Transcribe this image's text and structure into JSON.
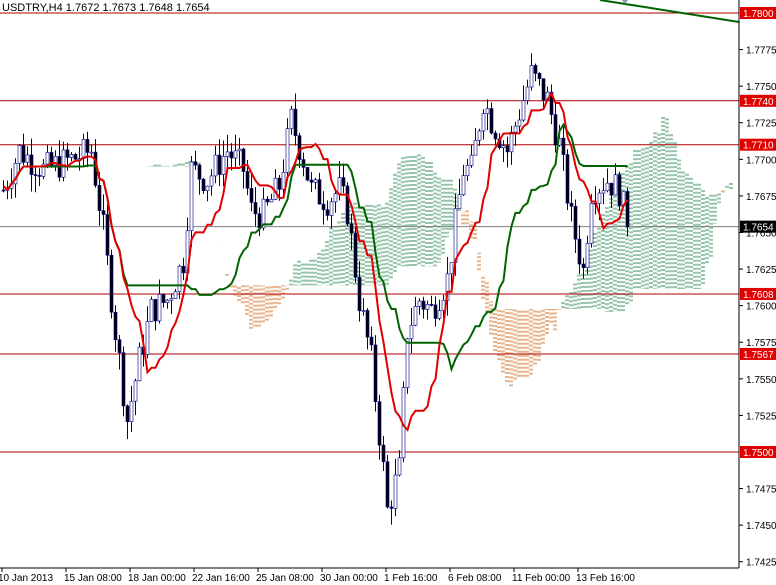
{
  "chart_data": {
    "type": "candlestick",
    "title": "USDTRY,H4",
    "ohlc_header": [
      "1.7672",
      "1.7673",
      "1.7648",
      "1.7654"
    ],
    "ylim": [
      1.7412,
      1.7809
    ],
    "y_ticks": [
      "1.7775",
      "1.7750",
      "1.7725",
      "1.7700",
      "1.7675",
      "1.7650",
      "1.7625",
      "1.7600",
      "1.7575",
      "1.7550",
      "1.7525",
      "1.7475",
      "1.7450",
      "1.7425"
    ],
    "x_labels": [
      "10 Jan 2013",
      "15 Jan 08:00",
      "18 Jan 00:00",
      "22 Jan 16:00",
      "25 Jan 08:00",
      "30 Jan 00:00",
      "1 Feb 16:00",
      "6 Feb 08:00",
      "11 Feb 00:00",
      "13 Feb 16:00"
    ],
    "bars_per_label": 16,
    "current_price": "1.7654",
    "levels": [
      "1.7800",
      "1.7740",
      "1.7710",
      "1.7608",
      "1.7567",
      "1.7500"
    ],
    "close_path_keypoints": [
      [
        0,
        1.7679
      ],
      [
        4,
        1.7706
      ],
      [
        10,
        1.7693
      ],
      [
        17,
        1.77
      ],
      [
        22,
        1.7706
      ],
      [
        25,
        1.7652
      ],
      [
        28,
        1.7583
      ],
      [
        31,
        1.7522
      ],
      [
        34,
        1.7563
      ],
      [
        37,
        1.7597
      ],
      [
        41,
        1.7604
      ],
      [
        45,
        1.7631
      ],
      [
        47,
        1.7693
      ],
      [
        51,
        1.7686
      ],
      [
        56,
        1.7706
      ],
      [
        60,
        1.7693
      ],
      [
        62,
        1.7665
      ],
      [
        65,
        1.7662
      ],
      [
        69,
        1.7682
      ],
      [
        72,
        1.7727
      ],
      [
        75,
        1.77
      ],
      [
        77,
        1.7679
      ],
      [
        81,
        1.7672
      ],
      [
        84,
        1.7679
      ],
      [
        86,
        1.7665
      ],
      [
        89,
        1.7604
      ],
      [
        92,
        1.7563
      ],
      [
        95,
        1.7488
      ],
      [
        96,
        1.746
      ],
      [
        99,
        1.7488
      ],
      [
        101,
        1.7583
      ],
      [
        104,
        1.7604
      ],
      [
        107,
        1.7597
      ],
      [
        111,
        1.7618
      ],
      [
        115,
        1.7693
      ],
      [
        117,
        1.7693
      ],
      [
        120,
        1.7741
      ],
      [
        122,
        1.7727
      ],
      [
        126,
        1.7706
      ],
      [
        130,
        1.7741
      ],
      [
        132,
        1.7758
      ],
      [
        136,
        1.7741
      ],
      [
        139,
        1.771
      ],
      [
        142,
        1.7659
      ],
      [
        145,
        1.7624
      ],
      [
        147,
        1.7679
      ],
      [
        151,
        1.7686
      ],
      [
        154,
        1.7679
      ],
      [
        156,
        1.7655
      ]
    ],
    "indicators": {
      "tenkan_period": 9,
      "kijun_period": 26,
      "senkou_b_period": 52,
      "shift": 26
    },
    "colors": {
      "bull": "#ffffff",
      "bear": "#000000",
      "wick": "#000080",
      "tenkan": "#e00000",
      "kijun": "#006400",
      "cloud_up": "#2e8b57",
      "cloud_down": "#d2691e",
      "level": "#b00000",
      "label_bg": "#e00000"
    }
  }
}
